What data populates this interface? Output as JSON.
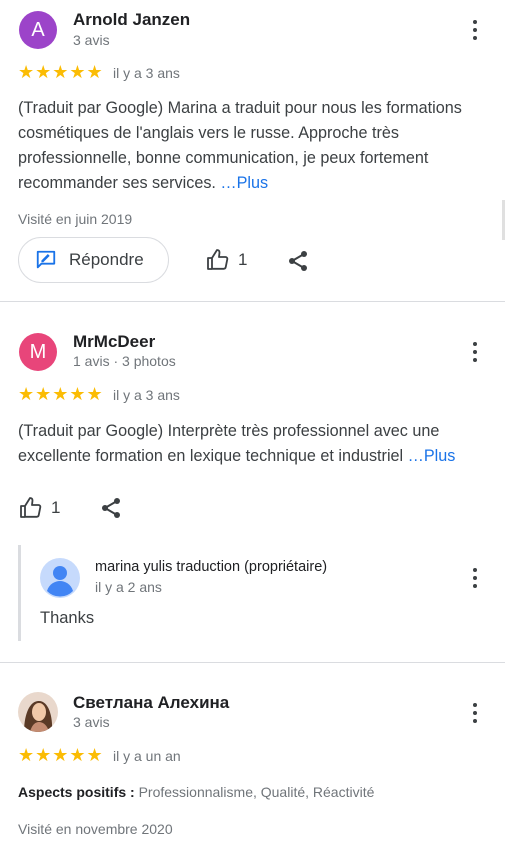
{
  "reviews": [
    {
      "avatar_letter": "A",
      "avatar_color": "#9c44c9",
      "name": "Arnold Janzen",
      "subtitle": "3 avis",
      "stars": "★★★★★",
      "age": "il y a 3 ans",
      "text": "(Traduit par Google) Marina a traduit pour nous les formations cosmétiques de l'anglais vers le russe. Approche très professionnelle, bonne communication, je peux fortement recommander ses services. ",
      "more": "…Plus",
      "visited": "Visité en juin 2019",
      "reply_label": "Répondre",
      "like_count": "1"
    },
    {
      "avatar_letter": "M",
      "avatar_color": "#e8457a",
      "name": "MrMcDeer",
      "subtitle": "1 avis · 3 photos",
      "stars": "★★★★★",
      "age": "il y a 3 ans",
      "text": "(Traduit par Google) Interprète très professionnel avec une excellente formation en lexique technique et industriel ",
      "more": "…Plus",
      "like_count": "1",
      "owner_reply": {
        "name": "marina yulis traduction (propriétaire)",
        "age": "il y a 2 ans",
        "text": "Thanks"
      }
    },
    {
      "name": "Светлана Алехина",
      "subtitle": "3 avis",
      "stars": "★★★★★",
      "age": "il y a un an",
      "aspects_label": "Aspects positifs :",
      "aspects_value": "Professionnalisme, Qualité, Réactivité",
      "visited": "Visité en novembre 2020"
    }
  ],
  "colors": {
    "star": "#fbbc04",
    "link": "#1a73e8",
    "reply_icon": "#1a73e8"
  }
}
